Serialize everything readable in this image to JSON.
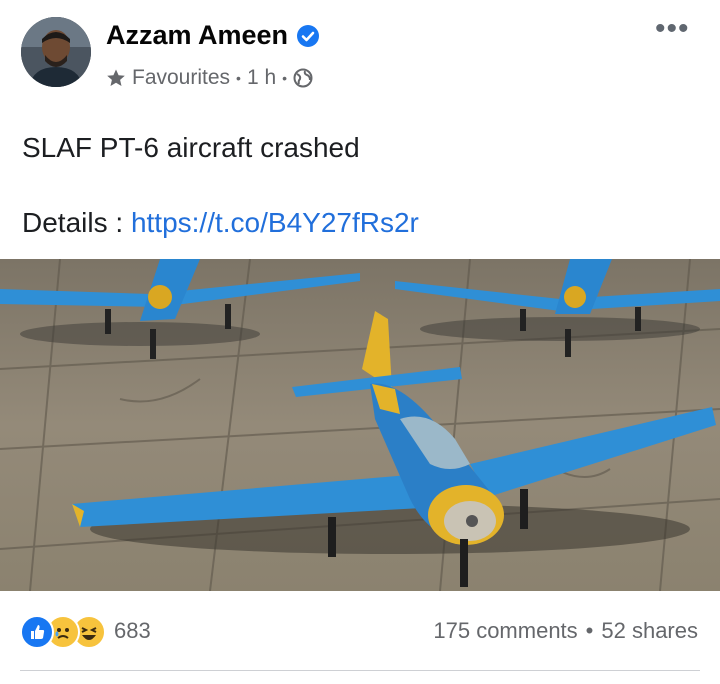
{
  "post": {
    "author": "Azzam Ameen",
    "audience": "Favourites",
    "time": "1 h",
    "text": "SLAF PT-6 aircraft crashed",
    "details_label": "Details :",
    "link": "https://t.co/B4Y27fRs2r"
  },
  "photo": {
    "subject": "blue and yellow PT-6 trainer aircraft on tarmac"
  },
  "engagement": {
    "reaction_count": "683",
    "reactions": [
      "like-icon",
      "sad-icon",
      "haha-icon"
    ],
    "comments": "175 comments",
    "shares": "52 shares"
  },
  "colors": {
    "link": "#216fdb",
    "meta": "#65676b",
    "like": "#1877f2",
    "verified": "#1877f2"
  }
}
